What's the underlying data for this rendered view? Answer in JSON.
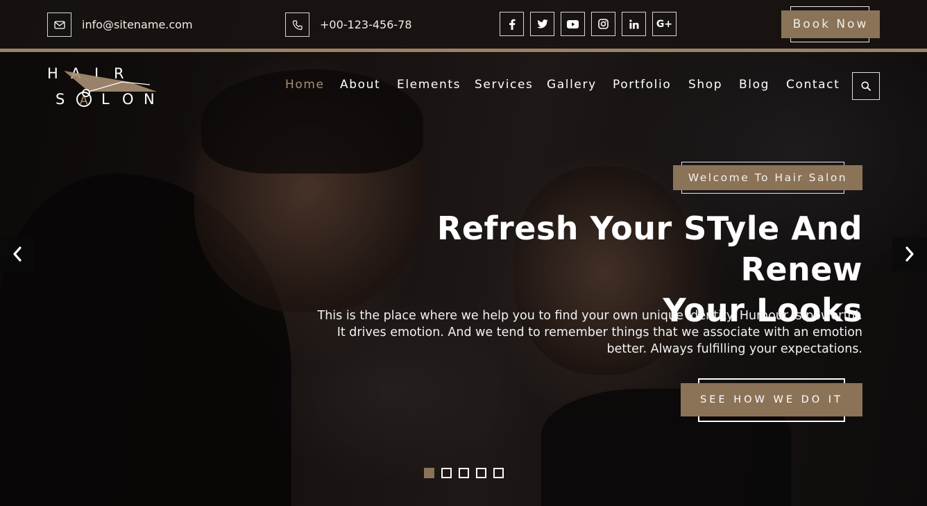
{
  "topbar": {
    "email": "info@sitename.com",
    "phone": "+00-123-456-78",
    "email_icon": "envelope-icon",
    "phone_icon": "phone-icon",
    "social": [
      {
        "name": "facebook-icon",
        "glyph": "f"
      },
      {
        "name": "twitter-icon",
        "glyph": ""
      },
      {
        "name": "youtube-icon",
        "glyph": ""
      },
      {
        "name": "instagram-icon",
        "glyph": ""
      },
      {
        "name": "linkedin-icon",
        "glyph": "in"
      },
      {
        "name": "google-plus-icon",
        "glyph": "G+"
      }
    ],
    "book_label": "Book Now"
  },
  "logo": {
    "line1": "HAIR",
    "line2": "SALON"
  },
  "nav": {
    "items": [
      "Home",
      "About",
      "Elements",
      "Services",
      "Gallery",
      "Portfolio",
      "Shop",
      "Blog",
      "Contact"
    ],
    "active_index": 0,
    "search_icon": "search-icon"
  },
  "slide": {
    "badge": "Welcome To Hair Salon",
    "headline_line1": "Refresh Your STyle And Renew",
    "headline_line2": "Your Looks",
    "desc_line1": "This is the place where we help you to find your own unique identity. Humour is powerful.",
    "desc_line2": "It drives emotion. And we tend to remember things that we associate with an emotion",
    "desc_line3": "better. Always fulfilling your expectations.",
    "cta": "SEE HOW WE DO IT"
  },
  "slider": {
    "total": 5,
    "current": 1,
    "prev_icon": "chevron-left-icon",
    "next_icon": "chevron-right-icon"
  },
  "colors": {
    "accent": "#8b7358",
    "active_nav": "#a88f73"
  }
}
